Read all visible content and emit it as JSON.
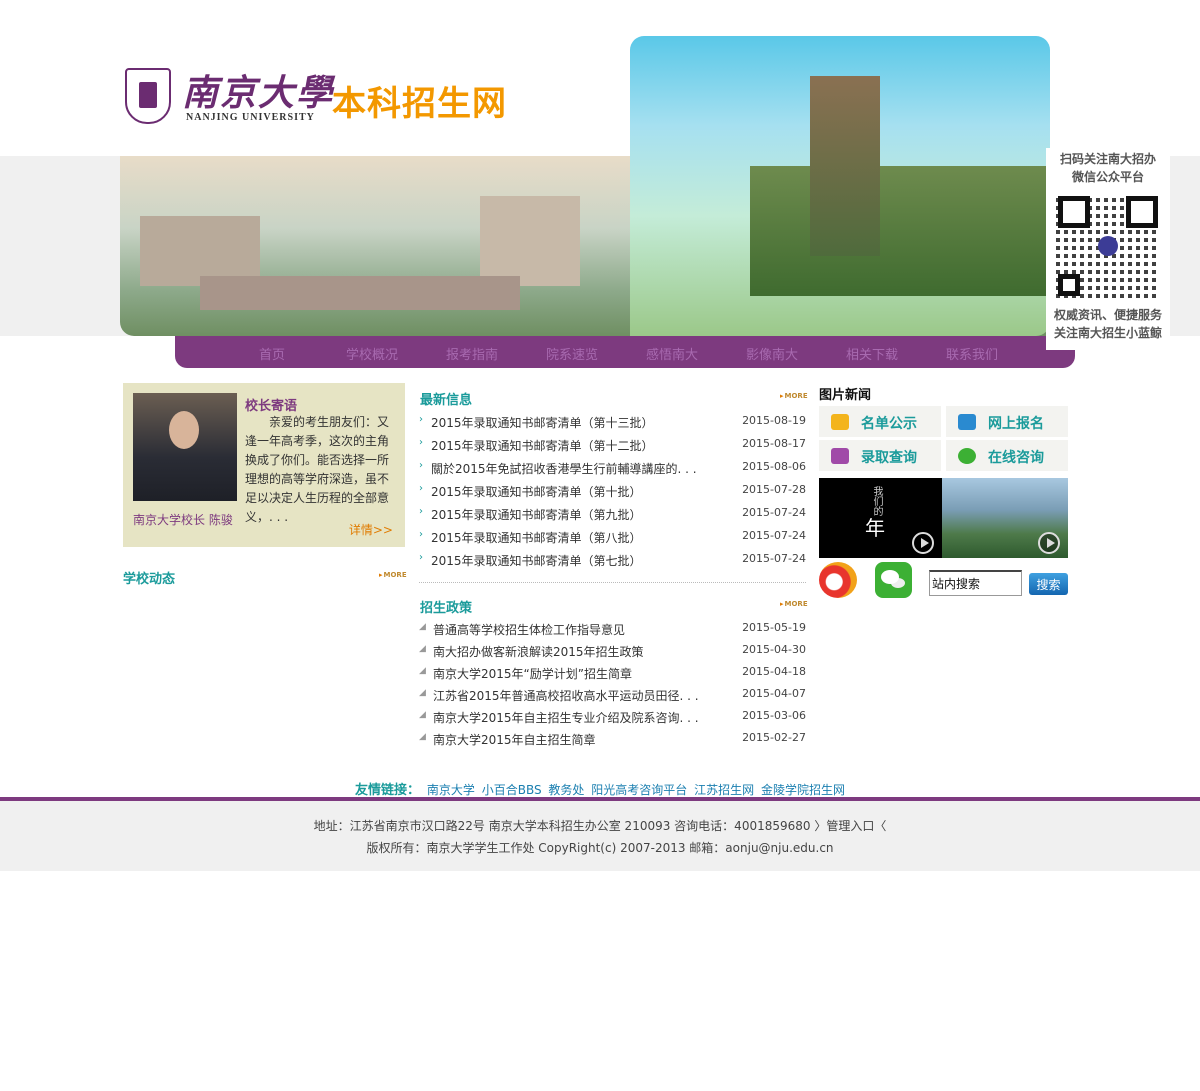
{
  "header": {
    "logo_cn": "南京大學",
    "logo_en": "NANJING UNIVERSITY",
    "site_title": "本科招生网"
  },
  "nav": {
    "items": [
      "首页",
      "学校概况",
      "报考指南",
      "院系速览",
      "感悟南大",
      "影像南大",
      "相关下载",
      "联系我们"
    ]
  },
  "qr_panel": {
    "top_line1": "扫码关注南大招办",
    "top_line2": "微信公众平台",
    "bottom_line1": "权威资讯、便捷服务",
    "bottom_line2": "关注南大招生小蓝鲸"
  },
  "president": {
    "title": "校长寄语",
    "text": "亲爱的考生朋友们：又逢一年高考季，这次的主角换成了你们。能否选择一所理想的高等学府深造，虽不足以决定人生历程的全部意义，. . .",
    "signature": "南京大学校长 陈骏",
    "more": "详情>>"
  },
  "school_news": {
    "title": "学校动态",
    "more": "MORE"
  },
  "latest": {
    "title": "最新信息",
    "more": "MORE",
    "items": [
      {
        "text": "2015年录取通知书邮寄清单（第十三批）",
        "date": "2015-08-19"
      },
      {
        "text": "2015年录取通知书邮寄清单（第十二批）",
        "date": "2015-08-17"
      },
      {
        "text": "關於2015年免試招收香港學生行前輔導講座的. . .",
        "date": "2015-08-06"
      },
      {
        "text": "2015年录取通知书邮寄清单（第十批）",
        "date": "2015-07-28"
      },
      {
        "text": "2015年录取通知书邮寄清单（第九批）",
        "date": "2015-07-24"
      },
      {
        "text": "2015年录取通知书邮寄清单（第八批）",
        "date": "2015-07-24"
      },
      {
        "text": "2015年录取通知书邮寄清单（第七批）",
        "date": "2015-07-24"
      }
    ]
  },
  "policy": {
    "title": "招生政策",
    "more": "MORE",
    "items": [
      {
        "text": "普通高等学校招生体检工作指导意见",
        "date": "2015-05-19"
      },
      {
        "text": "南大招办做客新浪解读2015年招生政策",
        "date": "2015-04-30"
      },
      {
        "text": "南京大学2015年“励学计划”招生简章",
        "date": "2015-04-18"
      },
      {
        "text": "江苏省2015年普通高校招收高水平运动员田径. . .",
        "date": "2015-04-07"
      },
      {
        "text": "南京大学2015年自主招生专业介绍及院系咨询. . .",
        "date": "2015-03-06"
      },
      {
        "text": "南京大学2015年自主招生简章",
        "date": "2015-02-27"
      }
    ]
  },
  "pictures": {
    "title": "图片新闻",
    "quick": [
      {
        "label": "名单公示",
        "icon": "list-card-icon",
        "color": "#f3b41c"
      },
      {
        "label": "网上报名",
        "icon": "id-card-icon",
        "color": "#2a8ad0"
      },
      {
        "label": "录取查询",
        "icon": "document-icon",
        "color": "#a04aa8"
      },
      {
        "label": "在线咨询",
        "icon": "chat-bubble-icon",
        "color": "#3cb034"
      }
    ],
    "video1_text": "年",
    "video1_small": "我们的"
  },
  "search": {
    "value": "站内搜索",
    "button": "搜索"
  },
  "friends": {
    "label": "友情链接：",
    "links": [
      "南京大学",
      "小百合BBS",
      "教务处",
      "阳光高考咨询平台",
      "江苏招生网",
      "金陵学院招生网"
    ]
  },
  "footer": {
    "line1": "地址：江苏省南京市汉口路22号 南京大学本科招生办公室 210093 咨询电话：4001859680 〉管理入口〈",
    "line2": "版权所有：南京大学学生工作处 CopyRight(c) 2007-2013 邮箱：aonju@nju.edu.cn"
  }
}
